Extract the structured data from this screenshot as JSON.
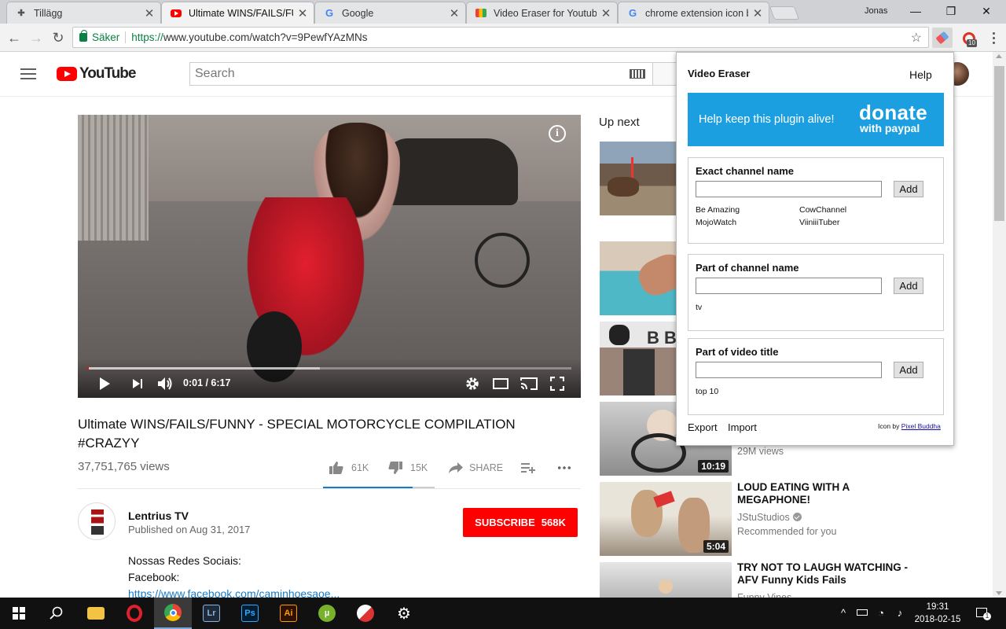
{
  "browser": {
    "tabs": [
      {
        "label": "Tillägg",
        "favicon": "puzzle-icon",
        "active": false
      },
      {
        "label": "Ultimate WINS/FAILS/FUNNY - SPECIAL MOTORCYCLE COMPILATION #CRAZYY",
        "favicon": "youtube-icon",
        "active": true
      },
      {
        "label": "Google",
        "favicon": "google-icon",
        "active": false
      },
      {
        "label": "Video Eraser for Youtube",
        "favicon": "webstore-icon",
        "active": false
      },
      {
        "label": "chrome extension icon bl",
        "favicon": "google-icon",
        "active": false
      }
    ],
    "user_name": "Jonas",
    "security_label": "Säker",
    "url_scheme": "https://",
    "url_rest": "www.youtube.com/watch?v=9PewfYAzMNs",
    "ext_badge": "10"
  },
  "youtube": {
    "logo_text": "YouTube",
    "search_placeholder": "Search",
    "video": {
      "time": "0:01 / 6:17",
      "progress_fraction": 0.003,
      "buffered_fraction": 0.48,
      "title": "Ultimate WINS/FAILS/FUNNY - SPECIAL MOTORCYCLE COMPILATION #CRAZYY",
      "views": "37,751,765 views",
      "likes": "61K",
      "dislikes": "15K",
      "like_fraction": 0.8,
      "share_label": "SHARE"
    },
    "channel": {
      "name": "Lentrius TV",
      "published": "Published on Aug 31, 2017",
      "subscribe_label": "SUBSCRIBE",
      "subscriber_count": "568K"
    },
    "description": {
      "line1": "Nossas Redes Sociais:",
      "line2": "Facebook:",
      "link": "https://www.facebook.com/caminhoesaoe..."
    },
    "up_next_label": "Up next",
    "related": [
      {
        "duration": "",
        "title": "",
        "channel": "",
        "meta": ""
      },
      {
        "duration": "",
        "title": "",
        "channel": "",
        "meta": ""
      },
      {
        "duration": "",
        "title": "",
        "channel": "",
        "meta": ""
      },
      {
        "duration": "10:19",
        "title": "",
        "channel": "",
        "meta": "29M views"
      },
      {
        "duration": "5:04",
        "title": "LOUD EATING WITH A MEGAPHONE!",
        "channel": "JStuStudios",
        "meta": "Recommended for you"
      },
      {
        "duration": "",
        "title": "TRY NOT TO LAUGH WATCHING - AFV Funny Kids Fails",
        "channel": "Funny Vines",
        "meta": ""
      }
    ]
  },
  "popup": {
    "title": "Video Eraser",
    "help": "Help",
    "donate_message": "Help keep this plugin alive!",
    "donate_big": "donate",
    "donate_sub": "with paypal",
    "sections": [
      {
        "label": "Exact channel name",
        "add": "Add",
        "entries": [
          "Be Amazing",
          "CowChannel",
          "MojoWatch",
          "ViiniiiTuber"
        ]
      },
      {
        "label": "Part of channel name",
        "add": "Add",
        "entries": [
          "tv"
        ]
      },
      {
        "label": "Part of video title",
        "add": "Add",
        "entries": [
          "top 10"
        ]
      }
    ],
    "export": "Export",
    "import": "Import",
    "credit_prefix": "Icon by",
    "credit_link": "Pixel Buddha"
  },
  "taskbar": {
    "time": "19:31",
    "date": "2018-02-15",
    "notification_count": "1"
  },
  "colors": {
    "youtube_red": "#ff0000",
    "donate_blue": "#1c9fe0",
    "link_blue": "#167ac6",
    "secure_green": "#0b8043"
  }
}
